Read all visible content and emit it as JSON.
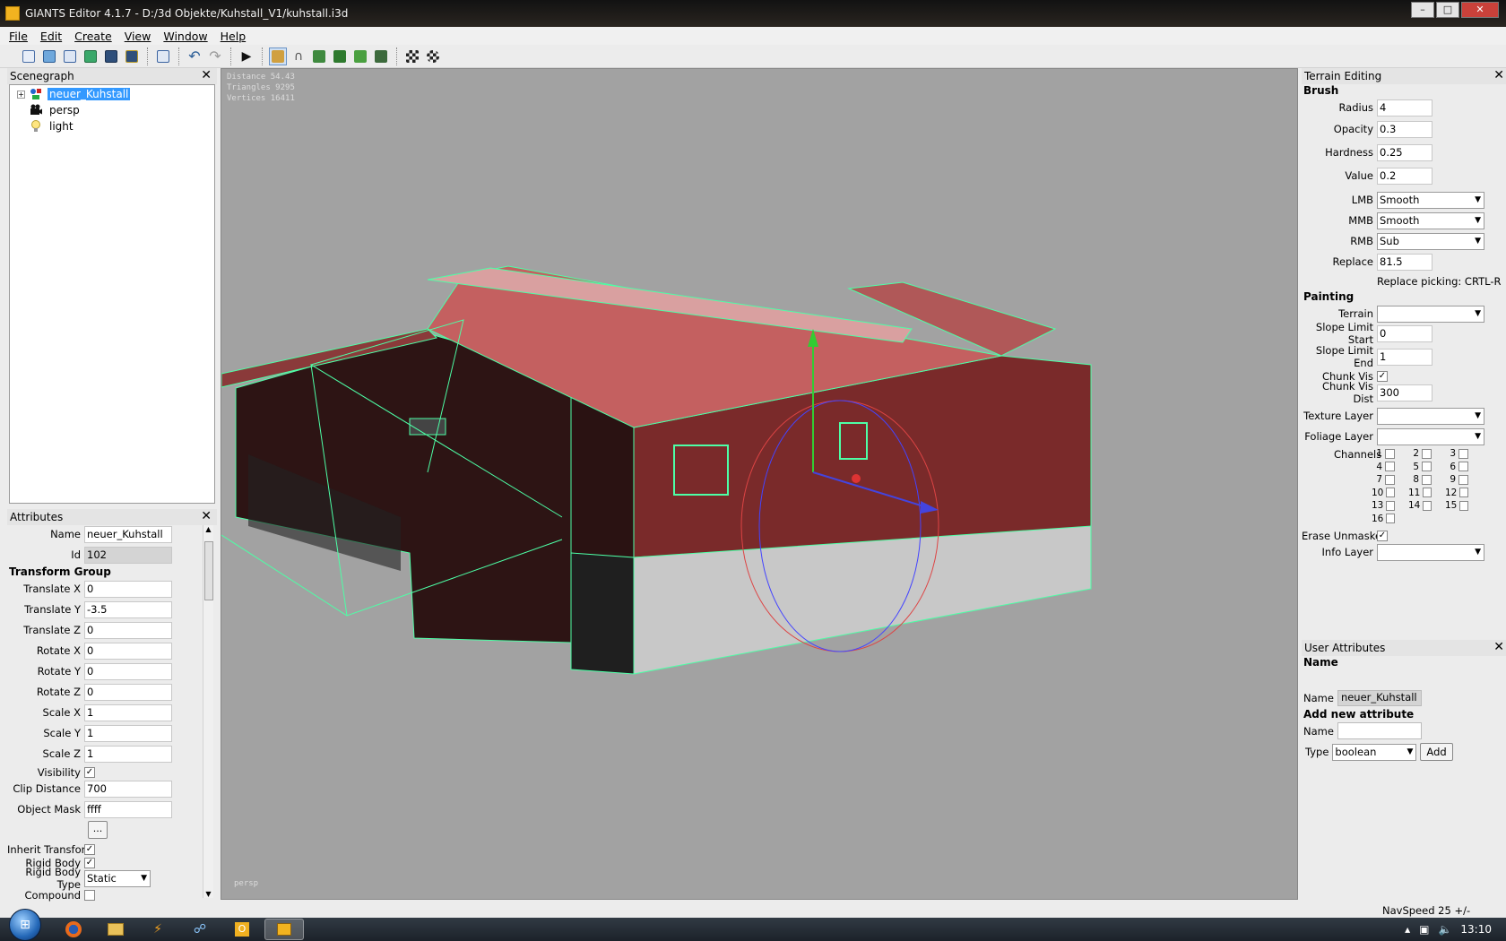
{
  "window": {
    "title": "GIANTS Editor 4.1.7 - D:/3d Objekte/Kuhstall_V1/kuhstall.i3d"
  },
  "menu": [
    "File",
    "Edit",
    "Create",
    "View",
    "Window",
    "Help"
  ],
  "toolbar_icons": [
    "new-file-icon",
    "open-file-icon",
    "save-list-icon",
    "refresh-icon",
    "save-icon",
    "save-as-icon",
    "import-icon",
    "undo-icon",
    "redo-icon",
    "play-icon",
    "select-terrain-icon",
    "sculpt-icon",
    "paint-icon",
    "foliage-icon",
    "grass-icon",
    "terrain-tool-icon",
    "checker-icon",
    "checker-settings-icon"
  ],
  "scenegraph": {
    "title": "Scenegraph",
    "nodes": [
      {
        "label": "neuer_Kuhstall",
        "icon": "transform-group-icon"
      },
      {
        "label": "persp",
        "icon": "camera-icon"
      },
      {
        "label": "light",
        "icon": "light-bulb-icon"
      }
    ]
  },
  "attributes": {
    "title": "Attributes",
    "name_label": "Name",
    "name_value": "neuer_Kuhstall",
    "id_label": "Id",
    "id_value": "102",
    "section": "Transform Group",
    "fields": [
      {
        "label": "Translate X",
        "value": "0"
      },
      {
        "label": "Translate Y",
        "value": "-3.5"
      },
      {
        "label": "Translate Z",
        "value": "0"
      },
      {
        "label": "Rotate X",
        "value": "0"
      },
      {
        "label": "Rotate Y",
        "value": "0"
      },
      {
        "label": "Rotate Z",
        "value": "0"
      },
      {
        "label": "Scale X",
        "value": "1"
      },
      {
        "label": "Scale Y",
        "value": "1"
      },
      {
        "label": "Scale Z",
        "value": "1"
      }
    ],
    "visibility_label": "Visibility",
    "visibility_checked": true,
    "clip_label": "Clip Distance",
    "clip_value": "700",
    "mask_label": "Object Mask",
    "mask_value": "ffff",
    "ellipsis": "...",
    "inherit_label": "Inherit Transform",
    "inherit_checked": true,
    "rigid_label": "Rigid Body",
    "rigid_checked": true,
    "rigid_type_label": "Rigid Body Type",
    "rigid_type_value": "Static",
    "compound_label": "Compound",
    "compound_checked": false
  },
  "viewport": {
    "distance": "Distance 54.43",
    "triangles": "Triangles 9295",
    "vertices": "Vertices 16411",
    "camera": "persp"
  },
  "terrain": {
    "title": "Terrain Editing",
    "brush_heading": "Brush",
    "radius_label": "Radius",
    "radius": "4",
    "opacity_label": "Opacity",
    "opacity": "0.3",
    "hardness_label": "Hardness",
    "hardness": "0.25",
    "value_label": "Value",
    "value": "0.2",
    "lmb_label": "LMB",
    "lmb": "Smooth",
    "mmb_label": "MMB",
    "mmb": "Smooth",
    "rmb_label": "RMB",
    "rmb": "Sub",
    "replace_label": "Replace",
    "replace": "81.5",
    "replace_picking": "Replace picking: CRTL-R",
    "painting_heading": "Painting",
    "terrain_label": "Terrain",
    "terrain_value": "",
    "slope_start_label": "Slope Limit Start",
    "slope_start": "0",
    "slope_end_label": "Slope Limit End",
    "slope_end": "1",
    "chunk_vis_label": "Chunk Vis",
    "chunk_vis_checked": true,
    "chunk_dist_label": "Chunk Vis Dist",
    "chunk_dist": "300",
    "texture_layer_label": "Texture Layer",
    "texture_layer": "",
    "foliage_layer_label": "Foliage Layer",
    "foliage_layer": "",
    "channels_label": "Channels",
    "channels": [
      "1",
      "2",
      "3",
      "4",
      "5",
      "6",
      "7",
      "8",
      "9",
      "10",
      "11",
      "12",
      "13",
      "14",
      "15",
      "16"
    ],
    "erase_label": "Erase Unmasked",
    "erase_checked": true,
    "info_layer_label": "Info Layer",
    "info_layer": ""
  },
  "user_attributes": {
    "title": "User Attributes",
    "name_heading": "Name",
    "name_label": "Name",
    "name_value": "neuer_Kuhstall",
    "add_heading": "Add new attribute",
    "new_name_label": "Name",
    "new_name_value": "",
    "type_label": "Type",
    "type_value": "boolean",
    "add_button": "Add"
  },
  "statusbar": {
    "navspeed": "NavSpeed 25 +/-"
  },
  "taskbar": {
    "apps": [
      "firefox-icon",
      "explorer-icon",
      "flash-icon",
      "network-icon",
      "outlook-icon",
      "giants-editor-icon"
    ],
    "time": "13:10"
  },
  "colors": {
    "wireframe": "#4dffa6",
    "roof": "#c46060",
    "wall": "#3a1818",
    "viewport_bg": "#a2a2a2",
    "selection": "#3399ff"
  }
}
